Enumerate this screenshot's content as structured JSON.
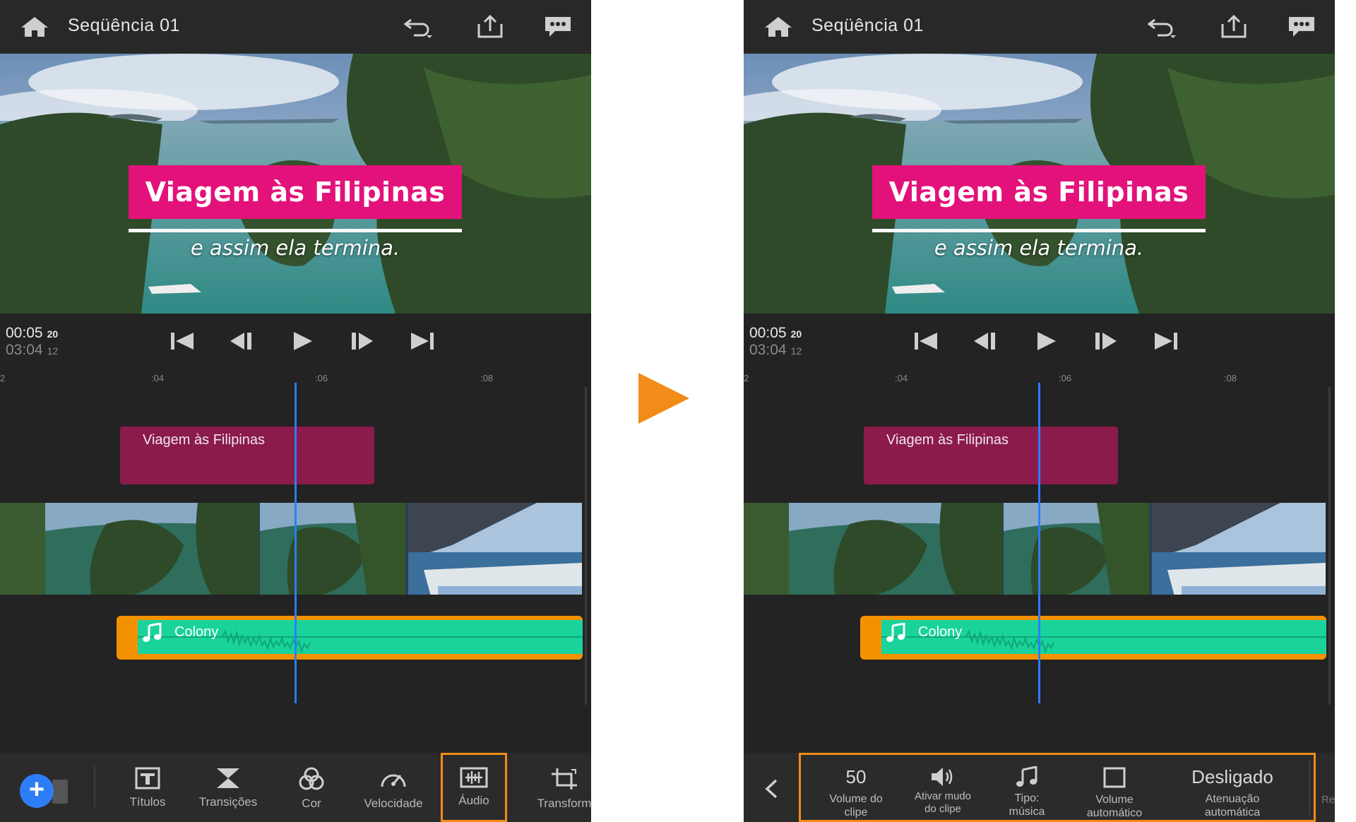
{
  "header": {
    "sequence_title": "Seqüência 01"
  },
  "preview": {
    "title_text": "Viagem às Filipinas",
    "subtitle_text": "e assim ela termina."
  },
  "transport": {
    "current_time": "00:05",
    "current_frames": "20",
    "total_time": "03:04",
    "total_frames": "12"
  },
  "timeline": {
    "ruler_edge": "2",
    "ruler_ticks": [
      ":04",
      ":06",
      ":08"
    ],
    "title_clip_label": "Viagem às Filipinas",
    "audio_clip_label": "Colony"
  },
  "toolbar_left": {
    "items": [
      {
        "label": "Títulos",
        "icon": "titles-icon"
      },
      {
        "label": "Transições",
        "icon": "transitions-icon"
      },
      {
        "label": "Cor",
        "icon": "color-icon"
      },
      {
        "label": "Velocidade",
        "icon": "speed-icon"
      },
      {
        "label": "Áudio",
        "icon": "audio-icon",
        "selected": true
      },
      {
        "label": "Transform",
        "icon": "transform-icon"
      }
    ]
  },
  "audio_panel": {
    "volume_value": "50",
    "volume_label": "Volume do clipe",
    "mute_label": "Ativar mudo do clipe",
    "type_label": "Tipo: música",
    "auto_volume_label": "Volume automático",
    "ducking_value": "Desligado",
    "ducking_label": "Atenuação automática",
    "cut_off_text": "Re"
  },
  "colors": {
    "accent_orange": "#f28c18",
    "title_pink": "#e3127a",
    "title_clip": "#8a1b4a",
    "audio_green": "#19d39a",
    "playhead_blue": "#2d7df6"
  }
}
